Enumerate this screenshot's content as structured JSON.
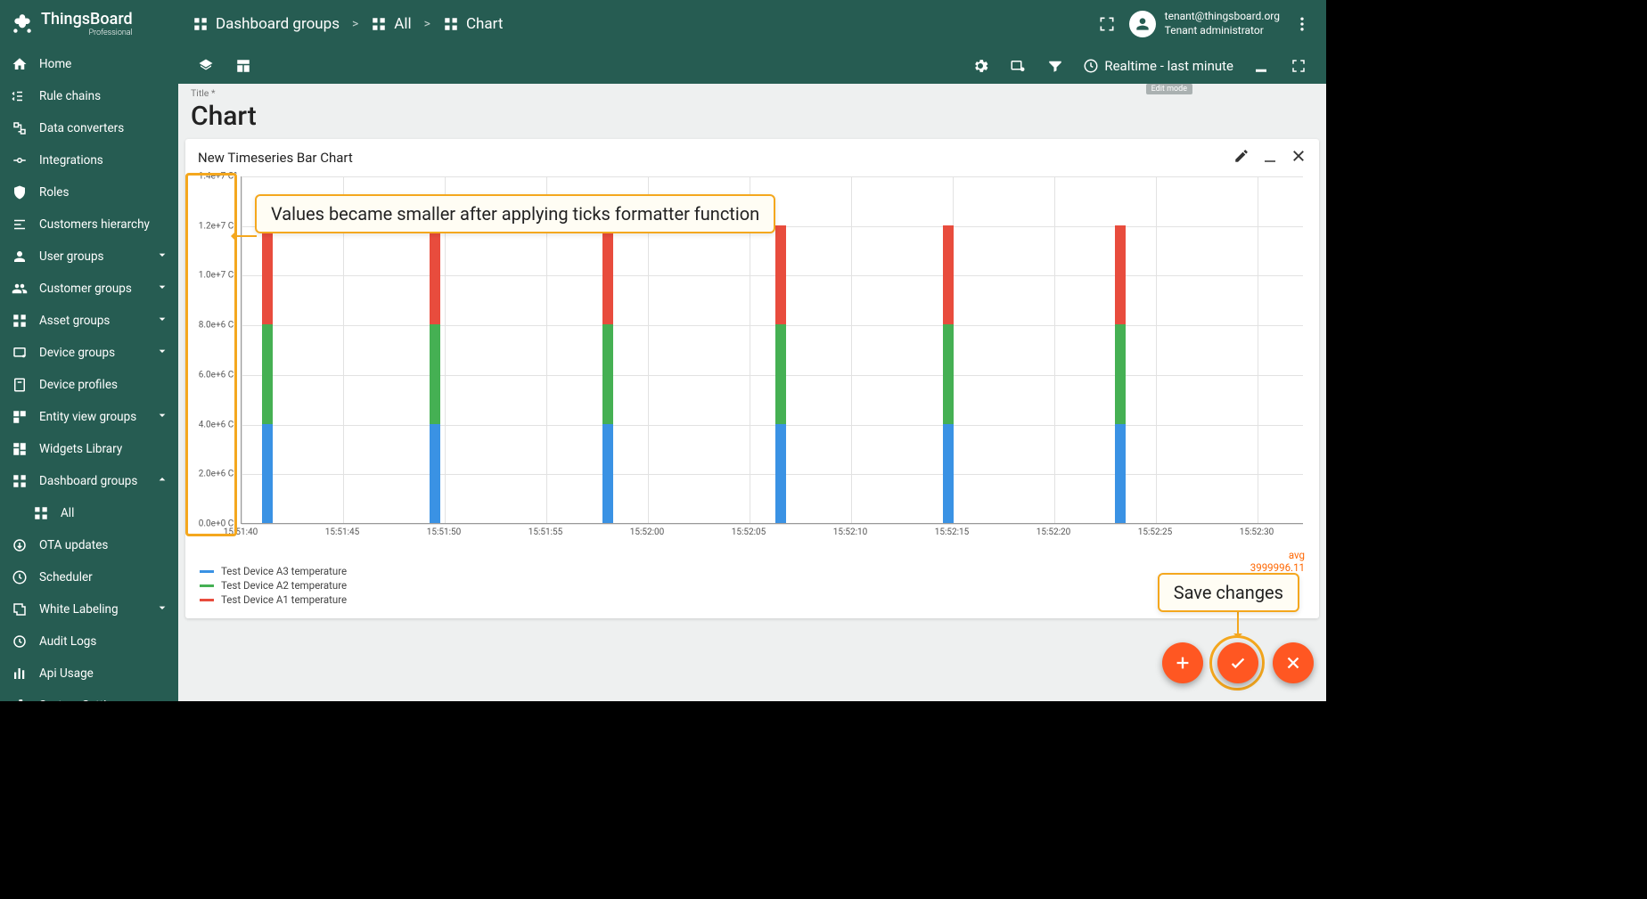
{
  "brand": {
    "name": "ThingsBoard",
    "edition": "Professional"
  },
  "breadcrumb": {
    "root": "Dashboard groups",
    "group": "All",
    "current": "Chart"
  },
  "user": {
    "email": "tenant@thingsboard.org",
    "role": "Tenant administrator"
  },
  "timewindow": "Realtime - last minute",
  "sidebar": [
    {
      "icon": "home",
      "label": "Home"
    },
    {
      "icon": "rule",
      "label": "Rule chains"
    },
    {
      "icon": "converter",
      "label": "Data converters"
    },
    {
      "icon": "integration",
      "label": "Integrations"
    },
    {
      "icon": "shield",
      "label": "Roles"
    },
    {
      "icon": "hierarchy",
      "label": "Customers hierarchy"
    },
    {
      "icon": "user",
      "label": "User groups",
      "expand": "down"
    },
    {
      "icon": "group",
      "label": "Customer groups",
      "expand": "down"
    },
    {
      "icon": "asset",
      "label": "Asset groups",
      "expand": "down"
    },
    {
      "icon": "device",
      "label": "Device groups",
      "expand": "down"
    },
    {
      "icon": "profile",
      "label": "Device profiles"
    },
    {
      "icon": "entity",
      "label": "Entity view groups",
      "expand": "down"
    },
    {
      "icon": "widget",
      "label": "Widgets Library"
    },
    {
      "icon": "dashboard",
      "label": "Dashboard groups",
      "expand": "up"
    },
    {
      "icon": "dashboard",
      "label": "All",
      "child": true
    },
    {
      "icon": "ota",
      "label": "OTA updates"
    },
    {
      "icon": "schedule",
      "label": "Scheduler"
    },
    {
      "icon": "whitelabel",
      "label": "White Labeling",
      "expand": "down"
    },
    {
      "icon": "audit",
      "label": "Audit Logs"
    },
    {
      "icon": "api",
      "label": "Api Usage"
    },
    {
      "icon": "settings",
      "label": "System Settings",
      "expand": "down"
    }
  ],
  "page": {
    "title_label": "Title *",
    "title": "Chart",
    "edit_badge": "Edit mode"
  },
  "widget": {
    "title": "New Timeseries Bar Chart"
  },
  "annotations": {
    "ticks": "Values became smaller after applying ticks formatter function",
    "save": "Save changes"
  },
  "legend_agg": {
    "label": "avg",
    "value": "3999996.11"
  },
  "chart_data": {
    "type": "bar",
    "stacked": true,
    "title": "New Timeseries Bar Chart",
    "xlabel": "",
    "ylabel": "",
    "ylim": [
      0,
      14000000
    ],
    "yticks": [
      "0.0e+0 C°",
      "2.0e+6 C°",
      "4.0e+6 C°",
      "6.0e+6 C°",
      "8.0e+6 C°",
      "1.0e+7 C°",
      "1.2e+7 C°",
      "1.4e+7 C°"
    ],
    "xticks": [
      "15:51:40",
      "15:51:45",
      "15:51:50",
      "15:51:55",
      "15:52:00",
      "15:52:05",
      "15:52:10",
      "15:52:15",
      "15:52:20",
      "15:52:25",
      "15:52:30"
    ],
    "categories": [
      "15:51:38",
      "15:51:48",
      "15:51:58",
      "15:52:08",
      "15:52:18",
      "15:52:28"
    ],
    "series": [
      {
        "name": "Test Device A3 temperature",
        "color": "#3a92e4",
        "values": [
          4000000,
          4000000,
          4000000,
          4000000,
          4000000,
          4000000
        ]
      },
      {
        "name": "Test Device A2 temperature",
        "color": "#45b053",
        "values": [
          4000000,
          4000000,
          4000000,
          4000000,
          4000000,
          4000000
        ]
      },
      {
        "name": "Test Device A1 temperature",
        "color": "#e84c3d",
        "values": [
          4000000,
          4000000,
          4000000,
          4000000,
          4000000,
          4000000
        ]
      }
    ]
  }
}
